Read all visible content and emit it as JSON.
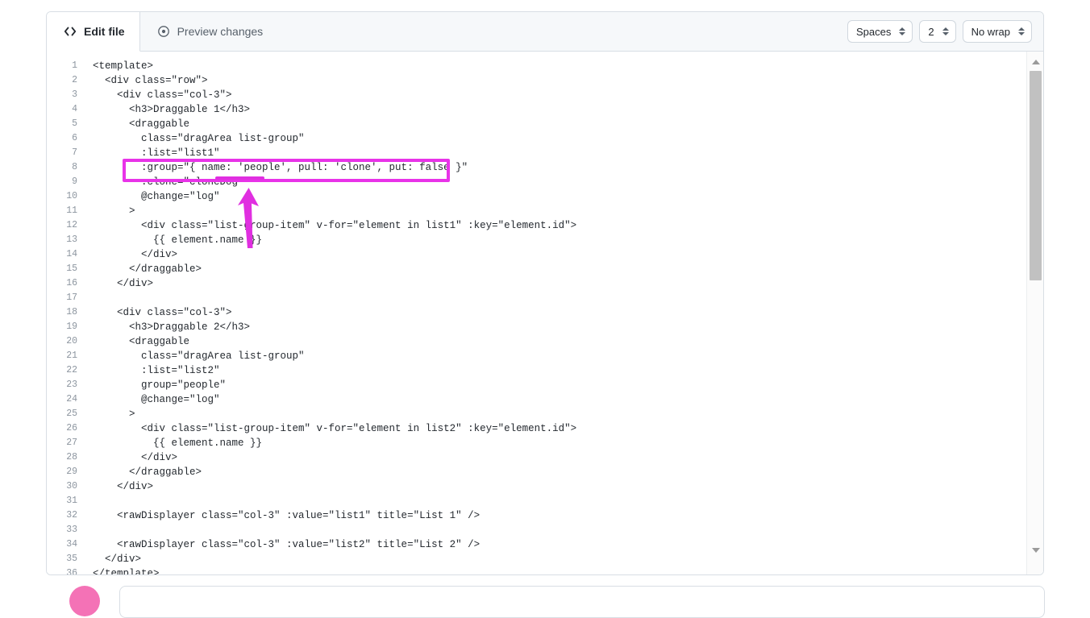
{
  "editor": {
    "tabs": [
      {
        "label": "Edit file",
        "icon": "code-brackets-icon",
        "active": true
      },
      {
        "label": "Preview changes",
        "icon": "eye-icon",
        "active": false
      }
    ],
    "toolbar": {
      "indent_mode": {
        "value": "Spaces",
        "name": "indent-mode-select"
      },
      "indent_size": {
        "value": "2",
        "name": "indent-size-select"
      },
      "wrap_mode": {
        "value": "No wrap",
        "name": "wrap-mode-select"
      }
    },
    "scrollbar": {
      "up_arrow": "scroll-up-arrow",
      "down_arrow": "scroll-down-arrow",
      "thumb": "scroll-thumb"
    },
    "code": {
      "language": "vue-html",
      "lines": [
        {
          "n": "1",
          "text": "<template>"
        },
        {
          "n": "2",
          "text": "  <div class=\"row\">"
        },
        {
          "n": "3",
          "text": "    <div class=\"col-3\">"
        },
        {
          "n": "4",
          "text": "      <h3>Draggable 1</h3>"
        },
        {
          "n": "5",
          "text": "      <draggable"
        },
        {
          "n": "6",
          "text": "        class=\"dragArea list-group\""
        },
        {
          "n": "7",
          "text": "        :list=\"list1\""
        },
        {
          "n": "8",
          "text": "        :group=\"{ name: 'people', pull: 'clone', put: false }\""
        },
        {
          "n": "9",
          "text": "        :clone=\"cloneDog\""
        },
        {
          "n": "10",
          "text": "        @change=\"log\""
        },
        {
          "n": "11",
          "text": "      >"
        },
        {
          "n": "12",
          "text": "        <div class=\"list-group-item\" v-for=\"element in list1\" :key=\"element.id\">"
        },
        {
          "n": "13",
          "text": "          {{ element.name }}"
        },
        {
          "n": "14",
          "text": "        </div>"
        },
        {
          "n": "15",
          "text": "      </draggable>"
        },
        {
          "n": "16",
          "text": "    </div>"
        },
        {
          "n": "17",
          "text": ""
        },
        {
          "n": "18",
          "text": "    <div class=\"col-3\">"
        },
        {
          "n": "19",
          "text": "      <h3>Draggable 2</h3>"
        },
        {
          "n": "20",
          "text": "      <draggable"
        },
        {
          "n": "21",
          "text": "        class=\"dragArea list-group\""
        },
        {
          "n": "22",
          "text": "        :list=\"list2\""
        },
        {
          "n": "23",
          "text": "        group=\"people\""
        },
        {
          "n": "24",
          "text": "        @change=\"log\""
        },
        {
          "n": "25",
          "text": "      >"
        },
        {
          "n": "26",
          "text": "        <div class=\"list-group-item\" v-for=\"element in list2\" :key=\"element.id\">"
        },
        {
          "n": "27",
          "text": "          {{ element.name }}"
        },
        {
          "n": "28",
          "text": "        </div>"
        },
        {
          "n": "29",
          "text": "      </draggable>"
        },
        {
          "n": "30",
          "text": "    </div>"
        },
        {
          "n": "31",
          "text": ""
        },
        {
          "n": "32",
          "text": "    <rawDisplayer class=\"col-3\" :value=\"list1\" title=\"List 1\" />"
        },
        {
          "n": "33",
          "text": ""
        },
        {
          "n": "34",
          "text": "    <rawDisplayer class=\"col-3\" :value=\"list2\" title=\"List 2\" />"
        },
        {
          "n": "35",
          "text": "  </div>"
        },
        {
          "n": "36",
          "text": "</template>"
        }
      ]
    }
  },
  "annotations": {
    "color": "#e833e8",
    "highlight_box": {
      "target_line": "8",
      "label": "group-option-highlight-box"
    },
    "underline": {
      "target_text": "people",
      "label": "people-underline"
    },
    "arrow": {
      "direction": "up",
      "label": "pointer-arrow"
    }
  },
  "bottom_bar": {
    "avatar_color": "#f472b6",
    "avatar_label": "user-avatar",
    "input_label": "message-input"
  }
}
